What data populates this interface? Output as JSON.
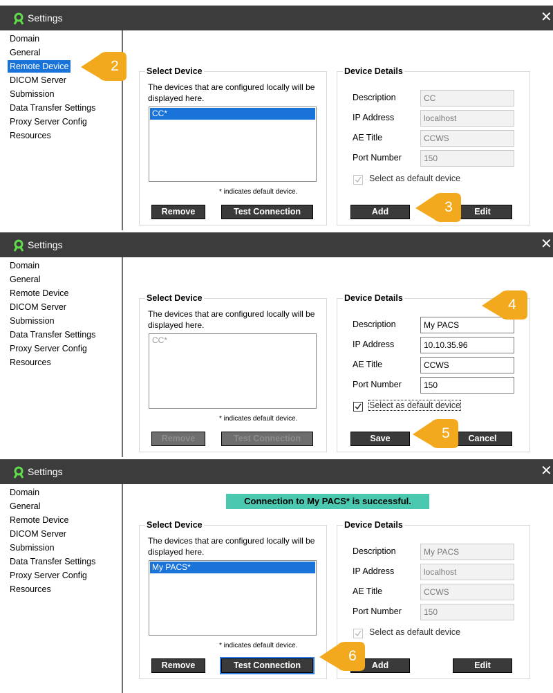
{
  "window": {
    "title": "Settings",
    "close_glyph": "✕",
    "logo_icon": "app-logo-icon"
  },
  "sidebar_items": [
    "Domain",
    "General",
    "Remote Device",
    "DICOM Server",
    "Submission",
    "Data Transfer Settings",
    "Proxy Server Config",
    "Resources"
  ],
  "select_device": {
    "heading": "Select Device",
    "description": "The devices that are configured locally will be displayed here.",
    "default_note": "* indicates default device.",
    "remove_label": "Remove",
    "test_label": "Test Connection"
  },
  "device_details": {
    "heading": "Device Details",
    "description_label": "Description",
    "ip_label": "IP Address",
    "ae_label": "AE Title",
    "port_label": "Port Number",
    "default_label": "Select as default device",
    "add_label": "Add",
    "edit_label": "Edit",
    "save_label": "Save",
    "cancel_label": "Cancel"
  },
  "step1": {
    "selected_nav": "Remote Device",
    "list_items": [
      "CC*"
    ],
    "description": "CC",
    "ip": "localhost",
    "ae": "CCWS",
    "port": "150",
    "default_checked": true,
    "callouts": [
      "2",
      "3"
    ]
  },
  "step2": {
    "list_items": [
      "CC*"
    ],
    "description": "My PACS",
    "ip": "10.10.35.96",
    "ae": "CCWS",
    "port": "150",
    "default_checked": true,
    "callouts": [
      "4",
      "5"
    ]
  },
  "step3": {
    "banner": "Connection to My PACS* is successful.",
    "list_items": [
      "My PACS*"
    ],
    "description": "My PACS",
    "ip": "localhost",
    "ae": "CCWS",
    "port": "150",
    "default_checked": true,
    "callouts": [
      "6"
    ]
  },
  "colors": {
    "titlebar": "#3c3c3c",
    "selection": "#1a73d9",
    "banner": "#4bc9b0",
    "callout": "#f2a91d",
    "button": "#3a3a3a"
  }
}
